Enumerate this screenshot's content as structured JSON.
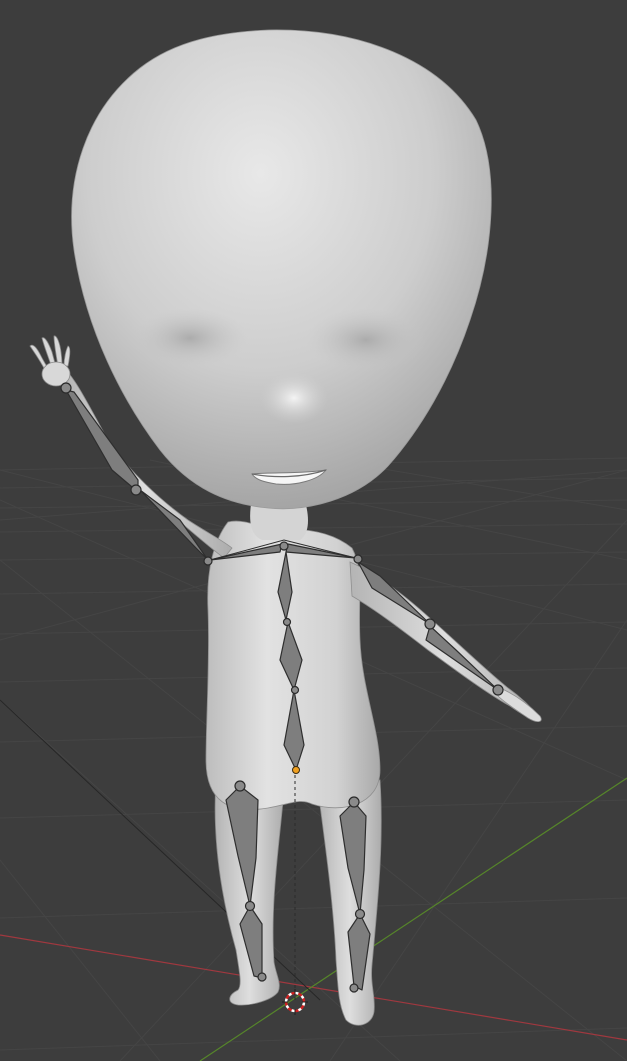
{
  "viewport": {
    "background_color": "#3d3d3d",
    "grid_color": "#454545",
    "axis_colors": {
      "x": "#a1383f",
      "y": "#56862a"
    },
    "mesh_color": "#c9c9c9",
    "armature_color": "#7e7e7e",
    "origin_color": "#f0a020",
    "cursor_icon": "3d-cursor-icon"
  }
}
